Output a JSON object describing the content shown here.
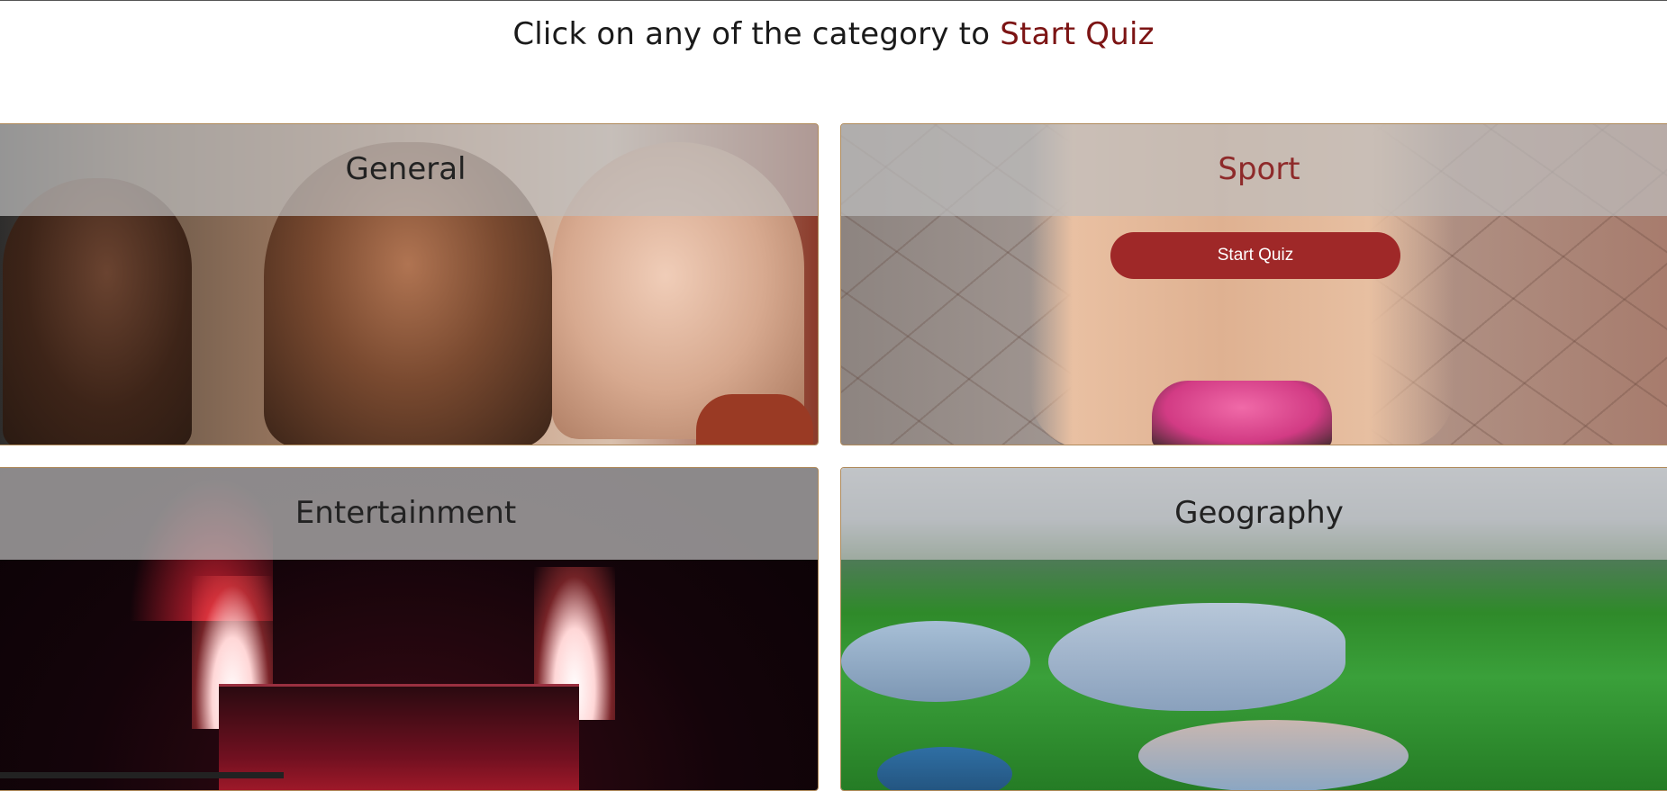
{
  "header": {
    "prefix": "Click on any of the category to ",
    "accent": "Start Quiz"
  },
  "cards": {
    "general": {
      "title": "General"
    },
    "sport": {
      "title": "Sport",
      "button_label": "Start Quiz"
    },
    "entertainment": {
      "title": "Entertainment"
    },
    "geography": {
      "title": "Geography"
    }
  },
  "colors": {
    "accent": "#7c1414",
    "button": "#9f2828",
    "card_border": "#b08a5a"
  }
}
